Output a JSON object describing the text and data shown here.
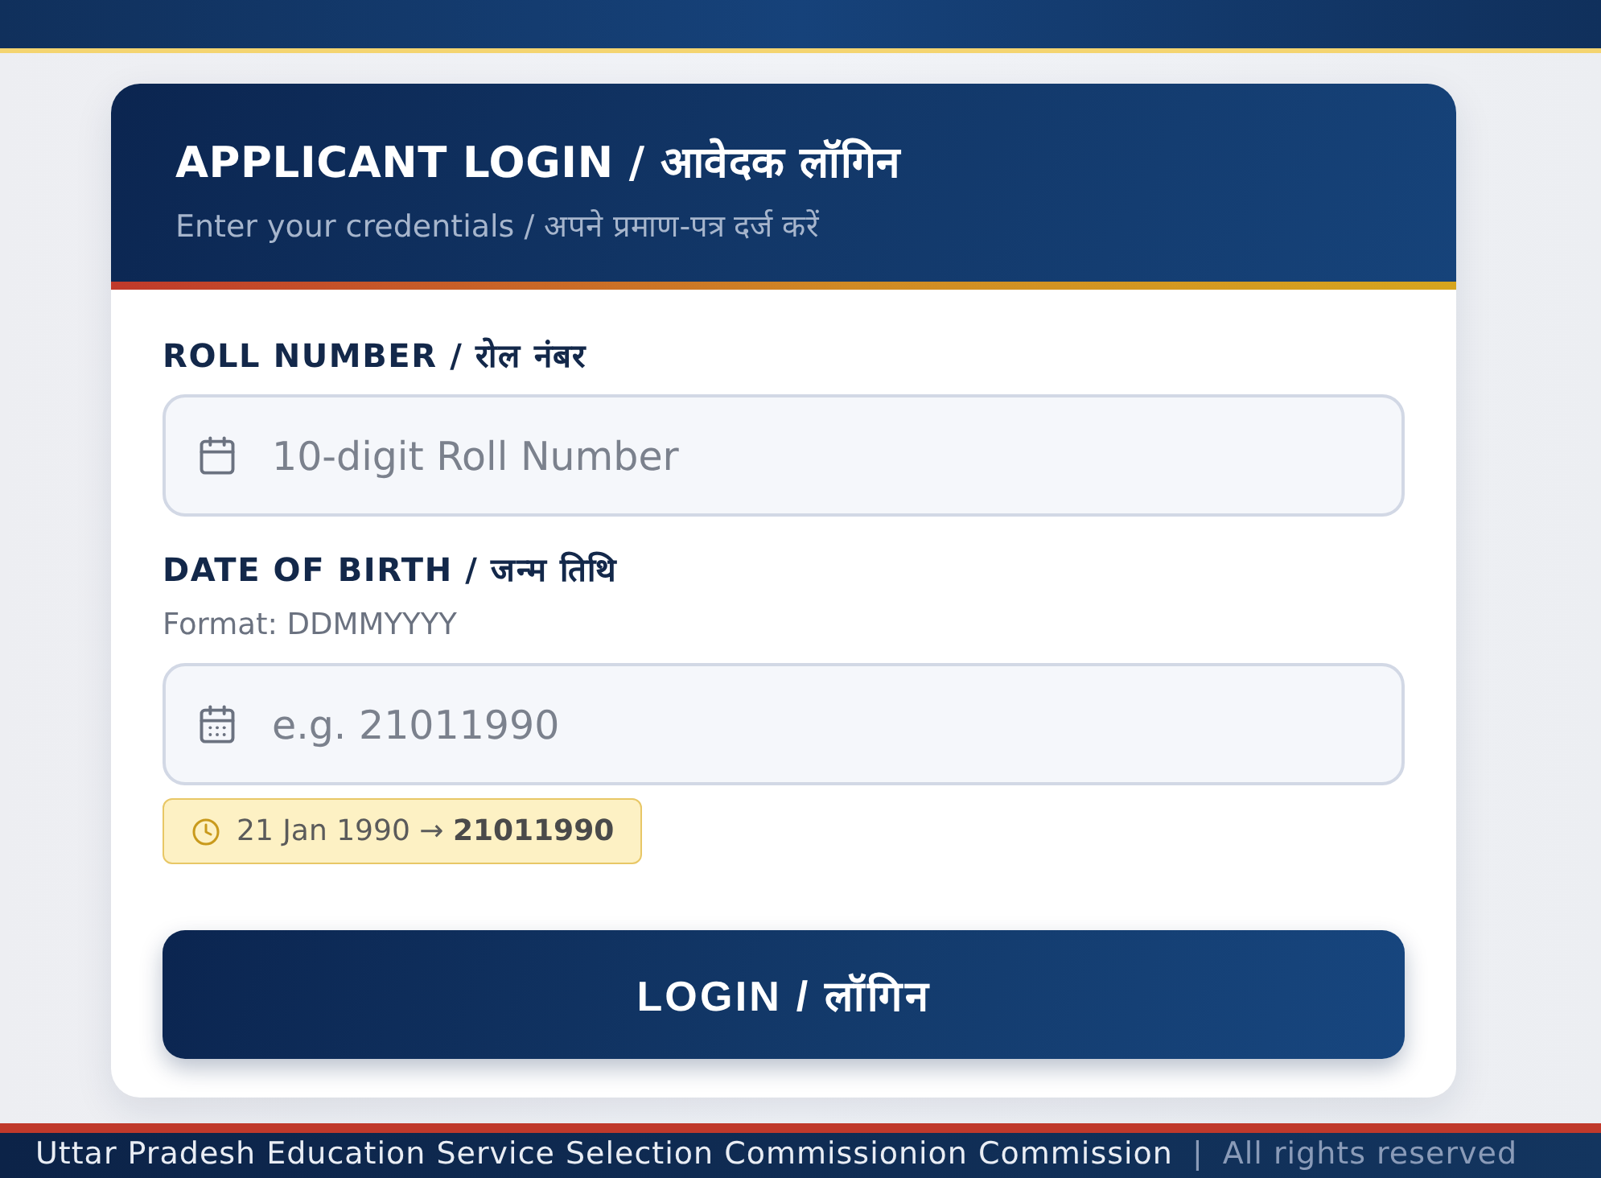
{
  "login_card": {
    "title": "APPLICANT LOGIN / आवेदक लॉगिन",
    "subtitle": "Enter your credentials / अपने प्रमाण-पत्र दर्ज करें"
  },
  "fields": [
    {
      "kind": "roll",
      "label": "ROLL NUMBER / रोल नंबर",
      "placeholder": "10-digit Roll Number"
    },
    {
      "kind": "date",
      "label": "DATE OF BIRTH / जन्म तिथि",
      "hint": "Format: DDMMYYYY",
      "placeholder": "e.g. 21011990",
      "example": "21 Jan 1990 → **21011990**"
    }
  ],
  "login_button": "LOGIN / लॉगिन",
  "footer": {
    "text": "Uttar Pradesh Education Service Selection Commissionion Commission",
    "separator": "|",
    "rights": "All rights reserved"
  }
}
